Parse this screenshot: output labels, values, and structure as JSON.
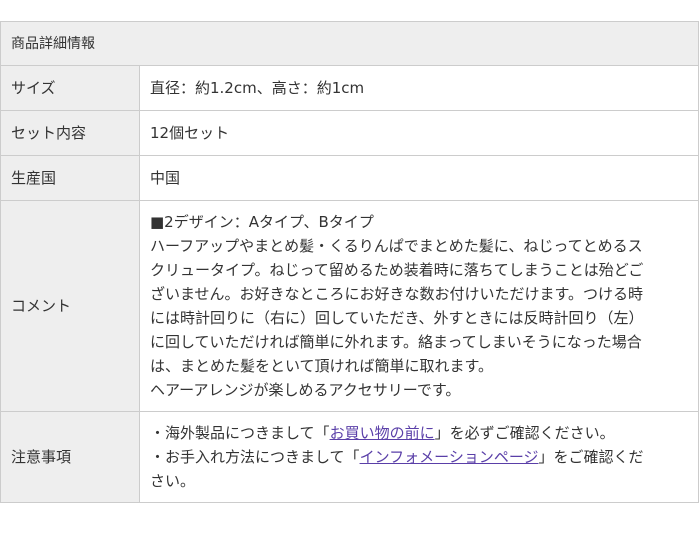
{
  "table_title": "商品詳細情報",
  "rows": {
    "size": {
      "label": "サイズ",
      "value": "直径：約1.2cm、高さ：約1cm"
    },
    "set": {
      "label": "セット内容",
      "value": "12個セット"
    },
    "origin": {
      "label": "生産国",
      "value": "中国"
    },
    "comment": {
      "label": "コメント",
      "lines": [
        "■2デザイン：Aタイプ、Bタイプ",
        "ハーフアップやまとめ髪・くるりんぱでまとめた髪に、ねじってとめるス",
        "クリュータイプ。ねじって留めるため装着時に落ちてしまうことは殆どご",
        "ざいません。お好きなところにお好きな数お付けいただけます。つける時",
        "には時計回りに（右に）回していただき、外すときには反時計回り（左）",
        "に回していただければ簡単に外れます。絡まってしまいそうになった場合",
        "は、まとめた髪をといて頂ければ簡単に取れます。",
        "ヘアーアレンジが楽しめるアクセサリーです。"
      ]
    },
    "notes": {
      "label": "注意事項",
      "line1_prefix": "・海外製品につきまして「",
      "line1_link": "お買い物の前に",
      "line1_suffix": "」を必ずご確認ください。",
      "line2_prefix": "・お手入れ方法につきまして「",
      "line2_link": "インフォメーションページ",
      "line2_suffix": "」をご確認くだ",
      "line3": "さい。"
    }
  }
}
